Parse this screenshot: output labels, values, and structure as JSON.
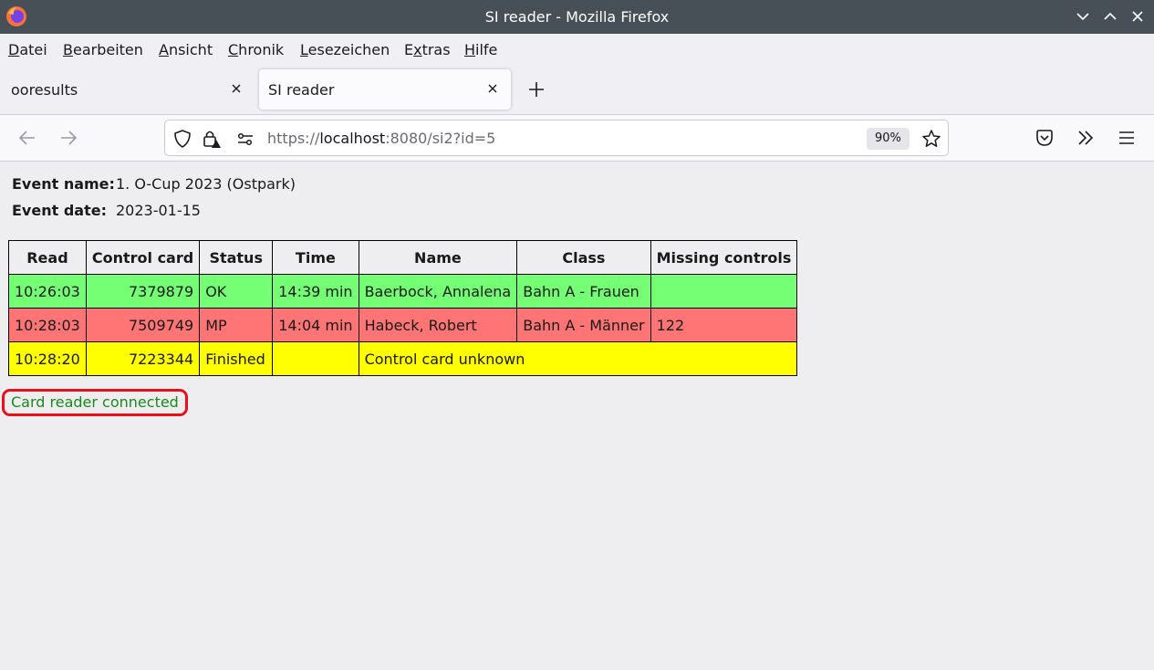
{
  "window": {
    "title": "SI reader - Mozilla Firefox"
  },
  "menu": [
    {
      "label": "Datei",
      "accel": "D",
      "rest": "atei"
    },
    {
      "label": "Bearbeiten",
      "accel": "B",
      "rest": "earbeiten"
    },
    {
      "label": "Ansicht",
      "accel": "A",
      "rest": "nsicht"
    },
    {
      "label": "Chronik",
      "accel": "C",
      "rest": "hronik"
    },
    {
      "label": "Lesezeichen",
      "accel": "L",
      "rest": "esezeichen"
    },
    {
      "label": "Extras",
      "pre": "E",
      "accel": "x",
      "rest": "tras"
    },
    {
      "label": "Hilfe",
      "accel": "H",
      "rest": "ilfe"
    }
  ],
  "tabs": [
    {
      "label": "ooresults",
      "active": false
    },
    {
      "label": "SI reader",
      "active": true
    }
  ],
  "urlbar": {
    "scheme": "https://",
    "host": "localhost",
    "rest": ":8080/si2?id=5",
    "zoom": "90%"
  },
  "event": {
    "name_label": "Event name:",
    "name_value": "1. O-Cup 2023 (Ostpark)",
    "date_label": "Event date:",
    "date_value": "2023-01-15"
  },
  "table": {
    "headers": [
      "Read",
      "Control card",
      "Status",
      "Time",
      "Name",
      "Class",
      "Missing controls"
    ],
    "rows": [
      {
        "kind": "ok",
        "read": "10:26:03",
        "card": "7379879",
        "status": "OK",
        "time": "14:39 min",
        "name": "Baerbock, Annalena",
        "class": "Bahn A - Frauen",
        "missing": ""
      },
      {
        "kind": "mp",
        "read": "10:28:03",
        "card": "7509749",
        "status": "MP",
        "time": "14:04 min",
        "name": "Habeck, Robert",
        "class": "Bahn A - Männer",
        "missing": "122"
      },
      {
        "kind": "unk",
        "read": "10:28:20",
        "card": "7223344",
        "status": "Finished",
        "time": "",
        "message": "Control card unknown"
      }
    ]
  },
  "status_text": "Card reader connected",
  "colors": {
    "ok_row": "#74ff74",
    "mp_row": "#ff7474",
    "unknown_row": "#ffff00",
    "status_text": "#1a8a1a",
    "status_outline": "#e8101a"
  }
}
